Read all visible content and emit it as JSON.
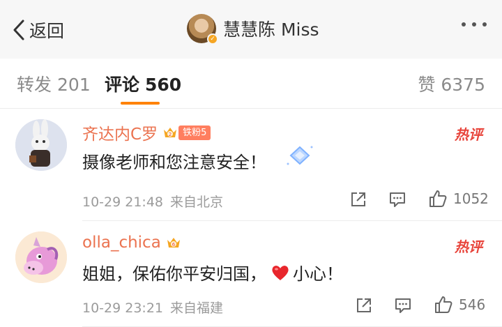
{
  "nav": {
    "back_label": "返回",
    "title": "慧慧陈 Miss",
    "more_icon": "more-dots-icon"
  },
  "tabs": {
    "repost_label": "转发",
    "repost_count": "201",
    "comment_label": "评论",
    "comment_count": "560",
    "like_label": "赞",
    "like_count": "6375",
    "active_color": "#ff8200"
  },
  "comments": [
    {
      "username": "齐达内C罗",
      "crown_level": "2",
      "fan_badge": "铁粉5",
      "hot_badge": "热评",
      "text": "摄像老师和您注意安全！",
      "time": "10-29 21:48",
      "location": "来自北京",
      "likes": "1052"
    },
    {
      "username": "olla_chica",
      "crown_level": "6",
      "hot_badge": "热评",
      "text_before": "姐姐，保佑你平安归国，",
      "text_after": "小心！",
      "time": "10-29 23:21",
      "location": "来自福建",
      "likes": "546"
    }
  ],
  "colors": {
    "username": "#eb7350",
    "hot": "#e8443b",
    "meta": "#9b9b9b"
  }
}
